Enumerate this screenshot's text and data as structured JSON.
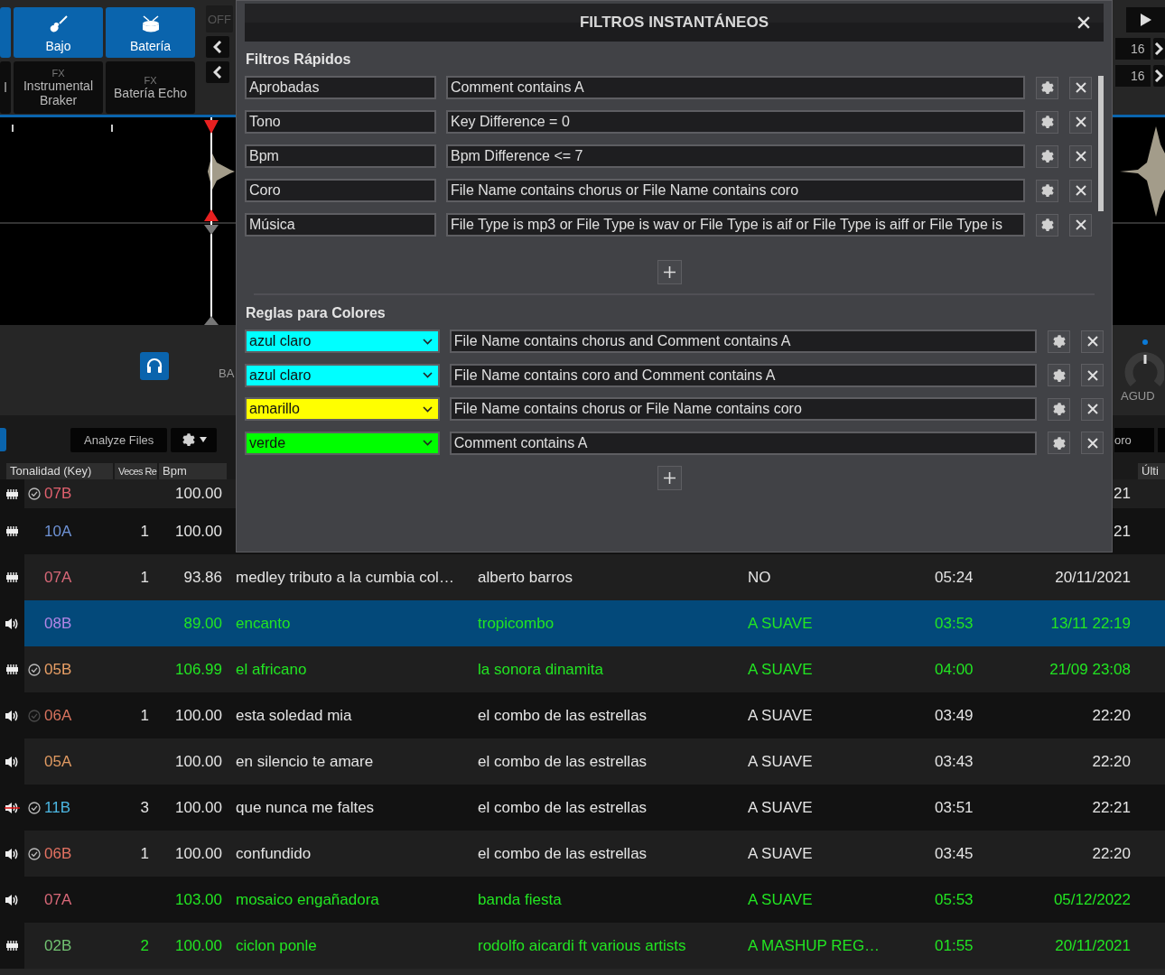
{
  "deck": {
    "pads": [
      {
        "label": "Bajo"
      },
      {
        "label": "Batería"
      }
    ],
    "fx_pads": [
      {
        "label": "l"
      },
      {
        "tag": "FX",
        "label": "Instrumental Braker"
      },
      {
        "tag": "FX",
        "label": "Batería Echo"
      }
    ],
    "off_button": "OFF",
    "counters": [
      "16",
      "16"
    ]
  },
  "mixer": {
    "left_label": "BA",
    "right_label": "AGUD"
  },
  "toolbar": {
    "analyze_button": "Analyze Files",
    "right_button": "oro"
  },
  "table": {
    "columns": [
      "Tonalidad (Key)",
      "Veces Re",
      "Bpm",
      "Últi"
    ],
    "rows": [
      {
        "kind": "deck",
        "checked": true,
        "dimmed": false,
        "key": "07B",
        "color": "#e0606e",
        "plays": "",
        "bpm": "100.00",
        "date": "21",
        "selected": false,
        "highlighted": false
      },
      {
        "kind": "deck",
        "checked": false,
        "key": "10A",
        "color": "#6f93d6",
        "plays": "1",
        "bpm": "100.00",
        "date": "21",
        "selected": false,
        "highlighted": false
      },
      {
        "kind": "deck",
        "checked": false,
        "key": "07A",
        "color": "#d86878",
        "plays": "1",
        "bpm": "93.86",
        "title": "medley tributo a la cumbia col…",
        "artist": "alberto barros",
        "comment": "NO",
        "time": "05:24",
        "date": "20/11/2021",
        "selected": false,
        "highlighted": false
      },
      {
        "kind": "speaker",
        "checked": false,
        "key": "08B",
        "color": "#b386e6",
        "plays": "",
        "bpm": "89.00",
        "title": "encanto",
        "artist": "tropicombo",
        "comment": "A SUAVE",
        "time": "03:53",
        "date": "13/11 22:19",
        "selected": true,
        "highlighted": true
      },
      {
        "kind": "deck",
        "checked": true,
        "dimmed": false,
        "key": "05B",
        "color": "#eaa066",
        "plays": "",
        "bpm": "106.99",
        "title": "el africano",
        "artist": "la sonora dinamita",
        "comment": "A SUAVE",
        "time": "04:00",
        "date": "21/09 23:08",
        "selected": false,
        "highlighted": true
      },
      {
        "kind": "speaker",
        "checked": true,
        "dimmed": true,
        "key": "06A",
        "color": "#d8735e",
        "plays": "1",
        "bpm": "100.00",
        "title": "esta soledad mia",
        "artist": "el combo de las estrellas",
        "comment": "A SUAVE",
        "time": "03:49",
        "date": "22:20",
        "selected": false,
        "highlighted": false
      },
      {
        "kind": "speaker",
        "checked": false,
        "key": "05A",
        "color": "#e09a62",
        "plays": "",
        "bpm": "100.00",
        "title": "en silencio te amare",
        "artist": "el combo de las estrellas",
        "comment": "A SUAVE",
        "time": "03:43",
        "date": "22:20",
        "selected": false,
        "highlighted": false
      },
      {
        "kind": "speaker-crossed",
        "checked": true,
        "dimmed": false,
        "key": "11B",
        "color": "#4cb8e4",
        "plays": "3",
        "bpm": "100.00",
        "title": "que nunca me faltes",
        "artist": "el combo de las estrellas",
        "comment": "A SUAVE",
        "time": "03:51",
        "date": "22:21",
        "selected": false,
        "highlighted": false
      },
      {
        "kind": "speaker",
        "checked": true,
        "dimmed": false,
        "key": "06B",
        "color": "#e47262",
        "plays": "1",
        "bpm": "100.00",
        "title": "confundido",
        "artist": "el combo de las estrellas",
        "comment": "A SUAVE",
        "time": "03:45",
        "date": "22:20",
        "selected": false,
        "highlighted": false
      },
      {
        "kind": "speaker",
        "checked": false,
        "key": "07A",
        "color": "#d86878",
        "plays": "",
        "bpm": "103.00",
        "title": "mosaico engañadora",
        "artist": "banda fiesta",
        "comment": "A SUAVE",
        "time": "05:53",
        "date": "05/12/2022",
        "selected": false,
        "highlighted": true
      },
      {
        "kind": "deck",
        "checked": false,
        "key": "02B",
        "color": "#72c472",
        "plays": "2",
        "bpm": "100.00",
        "title": "ciclon ponle",
        "artist": "rodolfo aicardi ft various artists",
        "comment": "A MASHUP REG…",
        "time": "01:55",
        "date": "20/11/2021",
        "selected": false,
        "highlighted": true
      }
    ]
  },
  "dialog": {
    "title": "FILTROS INSTANTÁNEOS",
    "quick_filters": {
      "title": "Filtros Rápidos",
      "rows": [
        {
          "name": "Aprobadas",
          "condition": "Comment contains A"
        },
        {
          "name": "Tono",
          "condition": "Key Difference = 0"
        },
        {
          "name": "Bpm",
          "condition": "Bpm Difference <= 7"
        },
        {
          "name": "Coro",
          "condition": "File Name contains chorus or File Name contains coro"
        },
        {
          "name": "Música",
          "condition": "File Type is mp3 or File Type is wav or File Type is aif or File Type is aiff or File Type is"
        }
      ]
    },
    "color_rules": {
      "title": "Reglas para Colores",
      "rows": [
        {
          "color_name": "azul claro",
          "color": "#00ffff",
          "condition": "File Name contains chorus and Comment contains A"
        },
        {
          "color_name": "azul claro",
          "color": "#00ffff",
          "condition": "File Name contains coro and Comment contains A"
        },
        {
          "color_name": "amarillo",
          "color": "#ffff00",
          "condition": "File Name contains chorus or File Name contains coro"
        },
        {
          "color_name": "verde",
          "color": "#00ff00",
          "condition": "Comment contains A"
        }
      ]
    }
  }
}
